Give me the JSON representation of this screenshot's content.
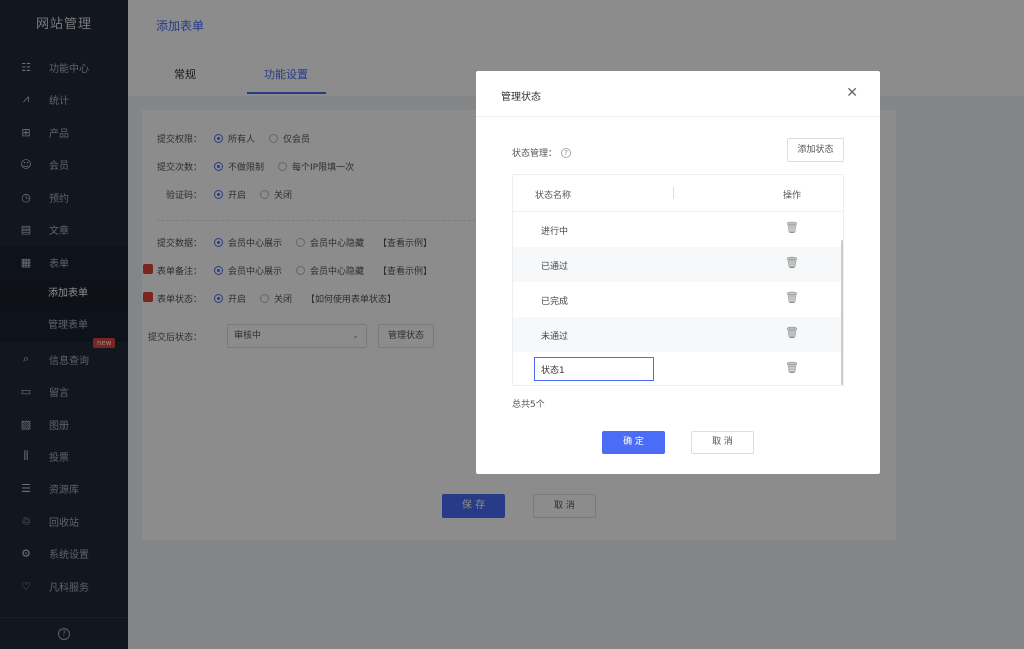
{
  "sidebar": {
    "brand": "网站管理",
    "items": [
      {
        "label": "功能中心",
        "icon": "grid-list-icon",
        "glyph": "☷"
      },
      {
        "label": "统计",
        "icon": "chart-line-icon",
        "glyph": "⩘"
      },
      {
        "label": "产品",
        "icon": "apps-icon",
        "glyph": "⊞"
      },
      {
        "label": "会员",
        "icon": "users-icon",
        "glyph": "☺"
      },
      {
        "label": "预约",
        "icon": "clock-icon",
        "glyph": "◷"
      },
      {
        "label": "文章",
        "icon": "document-icon",
        "glyph": "▤"
      },
      {
        "label": "表单",
        "icon": "form-icon",
        "glyph": "▦"
      }
    ],
    "sub_items": [
      {
        "label": "添加表单"
      },
      {
        "label": "管理表单"
      }
    ],
    "items_after": [
      {
        "label": "信息查询",
        "icon": "search-doc-icon",
        "glyph": "⌕"
      },
      {
        "label": "留言",
        "icon": "message-icon",
        "glyph": "▭"
      },
      {
        "label": "图册",
        "icon": "image-icon",
        "glyph": "▨"
      },
      {
        "label": "投票",
        "icon": "bar-chart-icon",
        "glyph": "⫼"
      },
      {
        "label": "资源库",
        "icon": "database-icon",
        "glyph": "☰"
      },
      {
        "label": "回收站",
        "icon": "trash-icon",
        "glyph": "♲"
      },
      {
        "label": "系统设置",
        "icon": "settings-icon",
        "glyph": "⚙"
      },
      {
        "label": "凡科服务",
        "icon": "heart-icon",
        "glyph": "♡"
      }
    ],
    "new_badge": "new",
    "help_glyph": "?"
  },
  "header": {
    "page_title": "添加表单",
    "tabs": [
      {
        "label": "常规"
      },
      {
        "label": "功能设置"
      }
    ]
  },
  "form": {
    "rows": [
      {
        "label": "提交权限：",
        "options": [
          "所有人",
          "仅会员"
        ]
      },
      {
        "label": "提交次数：",
        "options": [
          "不做限制",
          "每个IP限填一次"
        ]
      },
      {
        "label": "验证码：",
        "options": [
          "开启",
          "关闭"
        ]
      },
      {
        "label": "提交数据：",
        "options": [
          "会员中心展示",
          "会员中心隐藏"
        ],
        "note": "【查看示例】"
      },
      {
        "label": "表单备注：",
        "options": [
          "会员中心展示",
          "会员中心隐藏"
        ],
        "note": "【查看示例】"
      },
      {
        "label": "表单状态：",
        "options": [
          "开启",
          "关闭"
        ],
        "note": "【如何使用表单状态】"
      }
    ],
    "after_submit_label": "提交后状态：",
    "after_submit_value": "审核中",
    "manage_state_label": "管理状态",
    "save_label": "保 存",
    "cancel_label": "取 消"
  },
  "modal": {
    "title": "管理状态",
    "close_glyph": "✕",
    "state_manage_label": "状态管理：",
    "help_glyph": "?",
    "add_state_label": "添加状态",
    "table_headers": {
      "name": "状态名称",
      "op": "操作"
    },
    "rows": [
      {
        "name": "进行中"
      },
      {
        "name": "已通过"
      },
      {
        "name": "已完成"
      },
      {
        "name": "未通过"
      }
    ],
    "editing_value": "状态1",
    "delete_glyph": "🗑",
    "total_text": "总共5个",
    "ok_label": "确 定",
    "cancel_label": "取 消"
  },
  "colors": {
    "accent": "#4a6cf7",
    "sidebar_bg": "#22293a",
    "badge": "#e0443b"
  }
}
